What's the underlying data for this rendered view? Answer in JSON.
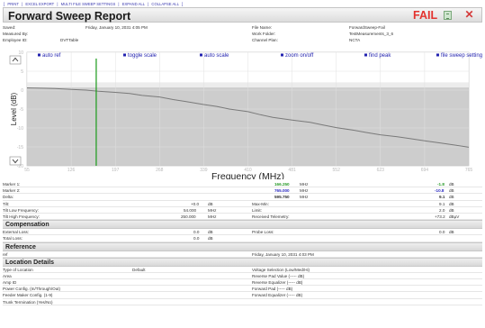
{
  "toolbar": {
    "print": "PRINT",
    "excel_export": "EXCEL EXPORT",
    "multi_file": "MULTI FILE SWEEP SETTINGS",
    "expand_all": "EXPAND ALL",
    "collapse_all": "COLLAPSE ALL",
    "separator": "|",
    "open_bracket": "[",
    "close_bracket": "]"
  },
  "header": {
    "title": "Forward Sweep Report",
    "status": "FAIL"
  },
  "info": {
    "saved_label": "Saved:",
    "saved_value": "Friday, January 10, 2031 4:05 PM",
    "measured_label": "Measured By:",
    "measured_value": "",
    "employee_label": "Employee ID:",
    "employee_value": "DVTTable",
    "file_label": "File Name:",
    "file_value": "ForwardSweep-Fail",
    "work_label": "Work Folder:",
    "work_value": "TestMeasurements_3_6",
    "channel_label": "Channel Plan:",
    "channel_value": "NCTA"
  },
  "chart_data": {
    "type": "line",
    "xlabel": "Frequency (MHz)",
    "ylabel": "Level (dB)",
    "xlim": [
      55,
      765
    ],
    "ylim": [
      -20,
      10
    ],
    "x_ticks": [
      "55",
      "126",
      "197",
      "268",
      "339",
      "410",
      "481",
      "552",
      "623",
      "694",
      "765"
    ],
    "y_ticks": [
      "10",
      "5",
      "0",
      "-5",
      "-10",
      "-15",
      "-20"
    ],
    "grid": true,
    "buttons": [
      "auto ref",
      "toggle scale",
      "auto scale",
      "zoom on/off",
      "find peak",
      "file sweep settings"
    ],
    "marker_x": 166.25,
    "limit_level": 2.0,
    "series": [
      {
        "x": [
          55,
          80,
          100,
          126,
          150,
          170,
          197,
          220,
          240,
          268,
          290,
          310,
          339,
          360,
          380,
          410,
          430,
          450,
          481,
          510,
          530,
          552,
          580,
          600,
          623,
          650,
          670,
          694,
          720,
          745,
          765
        ],
        "y": [
          0.6,
          0.5,
          0.4,
          0.2,
          0.0,
          -0.3,
          -0.6,
          -0.9,
          -1.4,
          -1.8,
          -2.5,
          -3.0,
          -3.8,
          -4.3,
          -5.0,
          -5.7,
          -6.5,
          -7.2,
          -7.9,
          -8.5,
          -9.2,
          -9.9,
          -10.6,
          -11.2,
          -11.8,
          -12.3,
          -12.8,
          -13.4,
          -14.0,
          -14.6,
          -15.1
        ]
      }
    ]
  },
  "measurements": {
    "marker1_label": "Marker 1:",
    "marker1_freq": "166.250",
    "marker1_freq_unit": "MHz",
    "marker1_level": "-1.8",
    "marker1_level_unit": "dB",
    "marker2_label": "Marker 2:",
    "marker2_freq": "765.000",
    "marker2_freq_unit": "MHz",
    "marker2_level": "-10.8",
    "marker2_level_unit": "dB",
    "delta_label": "Delta:",
    "delta_freq": "595.750",
    "delta_freq_unit": "MHz",
    "delta_level": "9.1",
    "delta_level_unit": "dB",
    "tilt_label": "Tilt:",
    "tilt_value": "+0.0",
    "tilt_unit": "dB",
    "maxmin_label": "Max-Min:",
    "maxmin_value": "9.1",
    "maxmin_unit": "dB",
    "tilt_low_label": "Tilt Low Frequency:",
    "tilt_low_value": "54.000",
    "tilt_low_unit": "MHz",
    "limit_label": "Limit:",
    "limit_value": "2.0",
    "limit_unit": "dB",
    "tilt_high_label": "Tilt High Frequency:",
    "tilt_high_value": "250.000",
    "tilt_high_unit": "MHz",
    "telemetry_label": "Received Telemetry:",
    "telemetry_value": "+73.2",
    "telemetry_unit": "dBµV"
  },
  "compensation": {
    "title": "Compensation",
    "external_label": "External Loss:",
    "external_value": "0.0",
    "external_unit": "dB",
    "probe_label": "Probe Loss:",
    "probe_value": "0.0",
    "probe_unit": "dB",
    "total_label": "Total Loss:",
    "total_value": "0.0",
    "total_unit": "dB"
  },
  "reference": {
    "title": "Reference",
    "ref_label": "ref",
    "ref_value": "Friday, January 10, 2031 4:03 PM"
  },
  "location": {
    "title": "Location Details",
    "type_label": "Type of Location",
    "type_value": "Default",
    "area_label": "Area",
    "amp_label": "Amp ID",
    "power_label": "Power Config. (In/Through/Out)",
    "feeder_label": "Feeder Maker Config. (1-9)",
    "trunk_label": "Trunk Termination (Yes/No)",
    "voltage_label": "Voltage Selection (Low/Med/Hi)",
    "rev_pad_label": "Reverse Pad Value (----- dB)",
    "rev_eq_label": "Reverse Equalizer (----- dB)",
    "fwd_pad_label": "Forward Pad (----- dB)",
    "fwd_eq_label": "Forward Equalizer (----- dB)"
  },
  "colors": {
    "fail": "#e3322e",
    "marker": "#1a9a1a",
    "button_text": "#2323b0",
    "trace": "#7a7a7a"
  }
}
